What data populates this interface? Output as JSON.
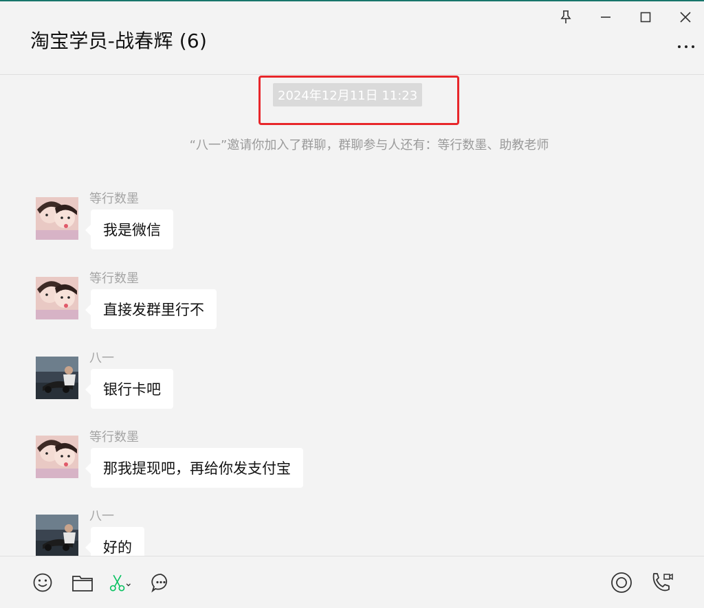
{
  "header": {
    "title": "淘宝学员-战春辉 (6)",
    "pin_icon": "pin-icon",
    "minimize_icon": "minimize-icon",
    "maximize_icon": "maximize-icon",
    "close_icon": "close-icon",
    "more_icon": "more-icon"
  },
  "chat": {
    "timestamp": "2024年12月11日 11:23",
    "highlight_color": "#e8262a",
    "system_message": "“八一”邀请你加入了群聊，群聊参与人还有：等行数墨、助教老师",
    "messages": [
      {
        "sender": "等行数墨",
        "text": "我是微信"
      },
      {
        "sender": "等行数墨",
        "text": "直接发群里行不"
      },
      {
        "sender": "八一",
        "text": "银行卡吧"
      },
      {
        "sender": "等行数墨",
        "text": "那我提现吧，再给你发支付宝"
      },
      {
        "sender": "八一",
        "text": "好的"
      }
    ]
  },
  "toolbar": {
    "left": [
      "emoji-icon",
      "folder-icon",
      "screenshot-scissors-icon",
      "chat-history-icon"
    ],
    "right": [
      "live-icon",
      "call-icon"
    ],
    "accent": "#07c160"
  }
}
